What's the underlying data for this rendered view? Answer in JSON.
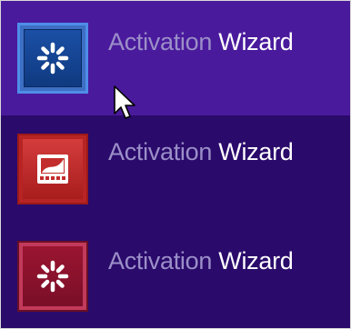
{
  "results": [
    {
      "title_dim": "Activation",
      "title_bright": "Wizard",
      "icon": "loading-sparkle-icon",
      "tile_color": "#1b4fa5",
      "selected": true
    },
    {
      "title_dim": "Activation",
      "title_bright": "Wizard",
      "icon": "film-slide-icon",
      "tile_color": "#c32c2c",
      "selected": false
    },
    {
      "title_dim": "Activation",
      "title_bright": "Wizard",
      "icon": "loading-sparkle-icon",
      "tile_color": "#8a1430",
      "selected": false
    }
  ],
  "colors": {
    "background": "#2a0a6b",
    "highlight": "#4a1a9c",
    "dim_text": "#9b8fc8",
    "bright_text": "#ffffff"
  }
}
